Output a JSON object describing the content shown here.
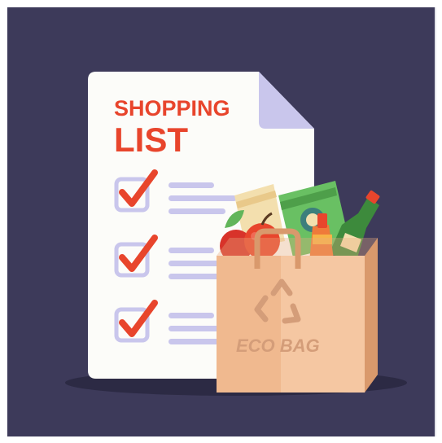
{
  "illustration": {
    "list_title_line1": "SHOPPING",
    "list_title_line2": "LIST",
    "bag_label": "ECO BAG",
    "checklist_items": [
      {
        "checked": true
      },
      {
        "checked": true
      },
      {
        "checked": true
      }
    ],
    "icons": {
      "checkmark": "checkmark-icon",
      "recycle": "recycle-icon"
    },
    "colors": {
      "background": "#3d3a5a",
      "paper": "#fcfcf9",
      "accent_red": "#e8452c",
      "lavender": "#c9c6ec",
      "bag": "#f0b98f"
    }
  }
}
